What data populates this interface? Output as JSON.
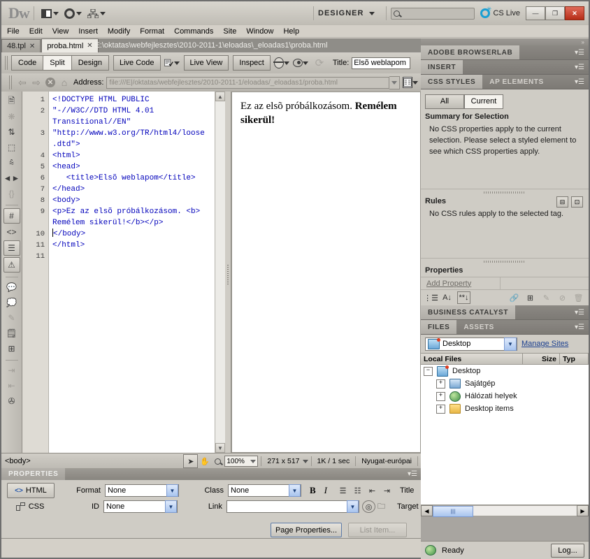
{
  "app": {
    "logo": "Dw",
    "workspace": "DESIGNER",
    "search_placeholder": "",
    "cs_live": "CS Live"
  },
  "window_controls": {
    "minimize": "—",
    "restore": "❐",
    "close": "✕"
  },
  "menu": [
    {
      "label": "File"
    },
    {
      "label": "Edit"
    },
    {
      "label": "View"
    },
    {
      "label": "Insert"
    },
    {
      "label": "Modify"
    },
    {
      "label": "Format"
    },
    {
      "label": "Commands"
    },
    {
      "label": "Site"
    },
    {
      "label": "Window"
    },
    {
      "label": "Help"
    }
  ],
  "tabs": [
    {
      "label": "48.tpl",
      "active": false
    },
    {
      "label": "proba.html",
      "active": true
    }
  ],
  "doc_path": "E:\\oktatas\\webfejlesztes\\2010-2011-1\\eloadas\\_eloadas1\\proba.html",
  "viewbar": {
    "code": "Code",
    "split": "Split",
    "design": "Design",
    "live_code": "Live Code",
    "live_view": "Live View",
    "inspect": "Inspect",
    "title_label": "Title:",
    "title_value": "Elsõ weblapom"
  },
  "addressbar": {
    "label": "Address:",
    "value": "file:///E|/oktatas/webfejlesztes/2010-2011-1/eloadas/_eloadas1/proba.html"
  },
  "coding_toolbar": [
    {
      "name": "open-documents-icon",
      "glyph": "🗎",
      "dim": false,
      "boxed": false
    },
    {
      "name": "collapse-full-tag-icon",
      "glyph": "❋",
      "dim": true,
      "boxed": false
    },
    {
      "name": "collapse-outside-selection-icon",
      "glyph": "⇅",
      "dim": false,
      "boxed": false
    },
    {
      "name": "expand-all-icon",
      "glyph": "⬚",
      "dim": false,
      "boxed": false
    },
    {
      "name": "select-parent-tag-icon",
      "glyph": "⩯",
      "dim": false,
      "boxed": false
    },
    {
      "name": "balance-braces-icon",
      "glyph": "◄►",
      "dim": false,
      "boxed": false
    },
    {
      "name": "line-numbers-icon",
      "glyph": "{}",
      "dim": true,
      "boxed": false
    },
    {
      "name": "highlight-invalid-code-icon",
      "glyph": "#",
      "dim": false,
      "boxed": true
    },
    {
      "name": "apply-comment-icon",
      "glyph": "<>",
      "dim": false,
      "boxed": false
    },
    {
      "name": "remove-comment-icon",
      "glyph": "☰",
      "dim": false,
      "boxed": true
    },
    {
      "name": "wrap-tag-icon",
      "glyph": "⚠",
      "dim": false,
      "boxed": true
    },
    {
      "name": "recent-snippets-icon",
      "glyph": "💬",
      "dim": false,
      "boxed": false
    },
    {
      "name": "move-css-rules-icon",
      "glyph": "💭",
      "dim": true,
      "boxed": false
    },
    {
      "name": "indent-code-icon",
      "glyph": "✎",
      "dim": true,
      "boxed": false
    },
    {
      "name": "outdent-code-icon",
      "glyph": "🗒",
      "dim": false,
      "boxed": false
    },
    {
      "name": "format-source-code-icon",
      "glyph": "⊞",
      "dim": false,
      "boxed": false
    },
    {
      "name": "indent-icon",
      "glyph": "⇥",
      "dim": true,
      "boxed": false
    },
    {
      "name": "outdent-icon",
      "glyph": "⇤",
      "dim": true,
      "boxed": false
    },
    {
      "name": "format-source-icon",
      "glyph": "✇",
      "dim": false,
      "boxed": false
    }
  ],
  "code": {
    "line_numbers": [
      "1",
      "2",
      "3",
      "4",
      "5",
      "6",
      "7",
      "8",
      "9",
      "10",
      "11"
    ],
    "lines": [
      "<!DOCTYPE HTML PUBLIC",
      "\"-//W3C//DTD HTML 4.01",
      "Transitional//EN\"",
      "\"http://www.w3.org/TR/html4/loose",
      ".dtd\">",
      "<html>",
      "<head>",
      "   <title>Elsõ weblapom</title>",
      "</head>",
      "<body>",
      "<p>Ez az elsõ próbálkozásom. <b>",
      "Remélem sikerül!</b></p>",
      "</body>",
      "</html>"
    ]
  },
  "design": {
    "text_plain": "Ez az elsõ próbálkozásom. ",
    "text_bold": "Remélem sikerül!"
  },
  "statusbar": {
    "tag_selector": "<body>",
    "zoom": "100%",
    "dimensions": "271 x 517",
    "size_time": "1K / 1 sec",
    "encoding": "Nyugat-európai"
  },
  "properties": {
    "header": "PROPERTIES",
    "html_btn": "HTML",
    "css_btn": "CSS",
    "format_label": "Format",
    "format_value": "None",
    "id_label": "ID",
    "id_value": "None",
    "class_label": "Class",
    "class_value": "None",
    "link_label": "Link",
    "link_value": "",
    "bold": "B",
    "italic": "I",
    "title_label": "Title",
    "target_label": "Target",
    "page_properties": "Page Properties...",
    "list_item": "List Item..."
  },
  "dock": {
    "browserlab": "ADOBE BROWSERLAB",
    "insert": "INSERT",
    "business_catalyst": "BUSINESS CATALYST",
    "css_styles_tab": "CSS STYLES",
    "ap_elements_tab": "AP ELEMENTS",
    "all_btn": "All",
    "current_btn": "Current",
    "summary_title": "Summary for Selection",
    "summary_text": "No CSS properties apply to the current selection.  Please select a styled element to see which CSS properties apply.",
    "rules_title": "Rules",
    "rules_text": "No CSS rules apply to the selected tag.",
    "properties_title": "Properties",
    "add_property": "Add Property",
    "files_tab": "FILES",
    "assets_tab": "ASSETS",
    "site_value": "Desktop",
    "manage_sites": "Manage Sites",
    "columns": [
      "Local Files",
      "Size",
      "Typ"
    ],
    "tree": [
      {
        "label": "Desktop",
        "icon": "site-icon",
        "expander": "−",
        "depth": 0
      },
      {
        "label": "Sajátgép",
        "icon": "computer-icon",
        "expander": "+",
        "depth": 1
      },
      {
        "label": "Hálózati helyek",
        "icon": "network-icon",
        "expander": "+",
        "depth": 1
      },
      {
        "label": "Desktop items",
        "icon": "folder-icon",
        "expander": "+",
        "depth": 1
      }
    ],
    "status_text": "Ready",
    "log_btn": "Log..."
  },
  "colors": {
    "chrome": "#d4d0c8",
    "code_text": "#0000bb",
    "link": "#1b3f8f",
    "close_red": "#b52d17",
    "cs_live_blue": "#1a9fd4"
  }
}
